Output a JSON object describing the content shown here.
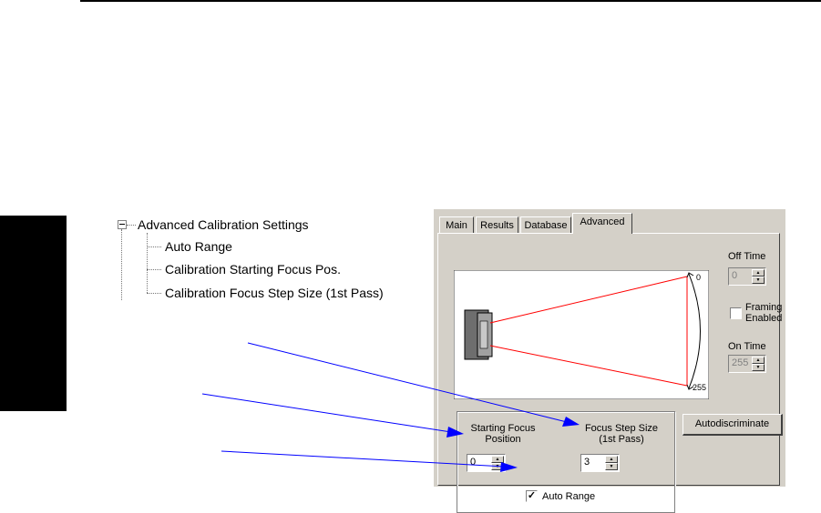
{
  "tree": {
    "root_label": "Advanced Calibration Settings",
    "children": [
      "Auto Range",
      "Calibration Starting Focus Pos.",
      "Calibration Focus Step Size (1st Pass)"
    ]
  },
  "dialog": {
    "tabs": [
      {
        "label": "Main",
        "active": false
      },
      {
        "label": "Results",
        "active": false
      },
      {
        "label": "Database",
        "active": false
      },
      {
        "label": "Advanced",
        "active": true
      }
    ],
    "diagram": {
      "top_value": "0",
      "bottom_value": "255"
    },
    "off_time": {
      "label": "Off Time",
      "value": "0"
    },
    "framing": {
      "label_line1": "Framing",
      "label_line2": "Enabled",
      "checked": false
    },
    "on_time": {
      "label": "On Time",
      "value": "255"
    },
    "starting_focus": {
      "label_line1": "Starting Focus",
      "label_line2": "Position",
      "value": "0"
    },
    "focus_step": {
      "label_line1": "Focus Step Size",
      "label_line2": "(1st Pass)",
      "value": "3"
    },
    "auto_range": {
      "label": "Auto Range",
      "checked": true
    },
    "autodiscriminate_label": "Autodiscriminate",
    "colors": {
      "dialog_bg": "#d4d0c8",
      "beam": "#ff0000",
      "arrow": "#0000ff"
    }
  }
}
